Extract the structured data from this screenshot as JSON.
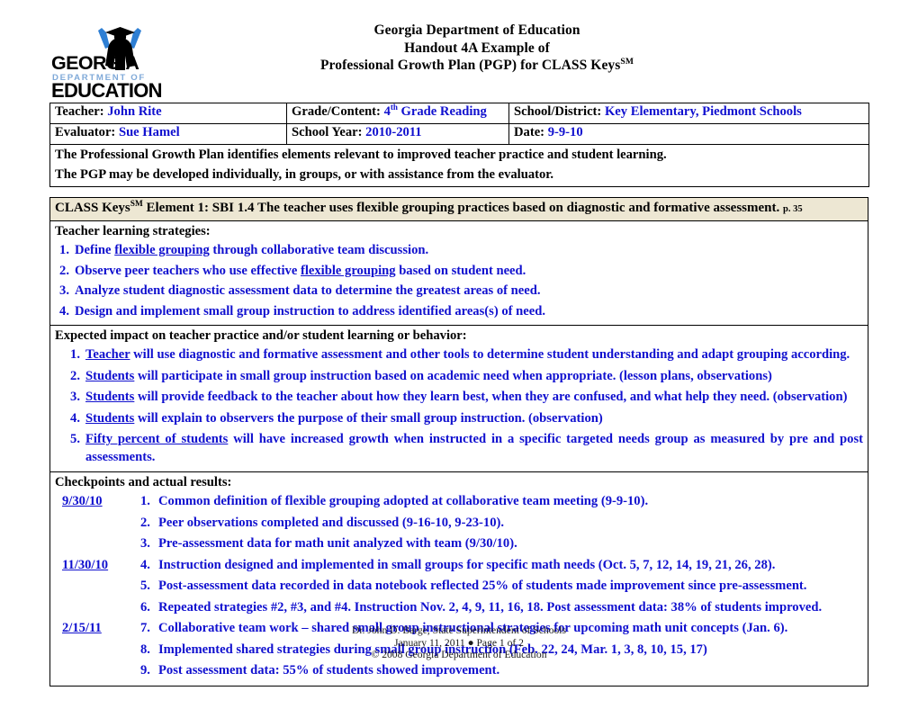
{
  "header": {
    "logo_alt": "Georgia Department of Education",
    "logo_word_top": "GEORGIA",
    "logo_word_mid": "DEPARTMENT OF",
    "logo_word_bottom": "EDUCATION",
    "title_line1": "Georgia Department of Education",
    "title_line2": "Handout 4A Example of",
    "title_line3_pre": "Professional Growth Plan (PGP) for CLASS Keys",
    "title_line3_sup": "SM"
  },
  "info": {
    "teacher_label": "Teacher:",
    "teacher_value": "John Rite",
    "grade_label": "Grade/Content:",
    "grade_value_num": "4",
    "grade_value_sup": "th",
    "grade_value_rest": " Grade Reading",
    "school_label": "School/District:",
    "school_value": "Key Elementary, Piedmont  Schools",
    "evaluator_label": "Evaluator:",
    "evaluator_value": "Sue Hamel",
    "year_label": "School Year:",
    "year_value": "2010-2011",
    "date_label": "Date:",
    "date_value": "9-9-10",
    "description_line1": "The Professional Growth Plan identifies elements relevant to improved teacher practice and student learning.",
    "description_line2": "The PGP may be developed individually, in groups, or with assistance from the evaluator."
  },
  "element": {
    "prefix": "CLASS Keys",
    "sup": "SM",
    "text": " Element 1:  SBI 1.4  The teacher uses flexible grouping practices based on diagnostic and formative assessment.",
    "page_ref": "p. 35"
  },
  "strategies": {
    "heading": "Teacher learning strategies:",
    "items": [
      {
        "num": "1.",
        "pre": "Define ",
        "underline": "flexible grouping",
        "post": " through collaborative team discussion."
      },
      {
        "num": "2.",
        "pre": "Observe peer teachers who use effective ",
        "underline": "flexible grouping",
        "post": " based on student need."
      },
      {
        "num": "3.",
        "pre": "Analyze student diagnostic assessment data to determine the greatest areas of need.",
        "underline": "",
        "post": ""
      },
      {
        "num": "4.",
        "pre": "Design and implement small group instruction to address identified areas(s) of need.",
        "underline": "",
        "post": ""
      }
    ]
  },
  "impact": {
    "heading": "Expected impact on teacher practice and/or student learning or behavior:",
    "items": [
      {
        "num": "1.",
        "underline": "Teacher",
        "post": " will use diagnostic and formative assessment and other tools to determine student understanding and adapt grouping according."
      },
      {
        "num": "2.",
        "underline": "Students",
        "post": " will participate in small group instruction based on academic need when appropriate. (lesson plans, observations)"
      },
      {
        "num": "3.",
        "underline": "Students",
        "post": " will provide feedback to the teacher about how they learn best, when they are confused, and what help they need. (observation)"
      },
      {
        "num": "4.",
        "underline": "Students",
        "post": " will explain to observers the purpose of their small group instruction. (observation)"
      },
      {
        "num": "5.",
        "underline": "Fifty percent of students",
        "post": " will have increased growth when instructed in a specific targeted needs group as measured by pre and post assessments."
      }
    ]
  },
  "checkpoints": {
    "heading": "Checkpoints and actual results:",
    "rows": [
      {
        "date": "9/30/10",
        "num": "1.",
        "text": "Common definition of flexible grouping adopted at collaborative team meeting (9-9-10)."
      },
      {
        "date": "",
        "num": "2.",
        "text": "Peer observations completed and discussed (9-16-10, 9-23-10)."
      },
      {
        "date": "",
        "num": "3.",
        "text": "Pre-assessment data for math unit analyzed with team (9/30/10)."
      },
      {
        "date": "11/30/10 ",
        "num": "4.",
        "text": "Instruction designed and implemented in small groups for specific math needs (Oct. 5, 7, 12, 14, 19, 21, 26, 28)."
      },
      {
        "date": "",
        "num": "5.",
        "text": "Post-assessment data recorded in data notebook reflected 25% of students made improvement since pre-assessment."
      },
      {
        "date": "",
        "num": "6.",
        "text": "Repeated strategies #2, #3, and #4.  Instruction Nov. 2, 4, 9, 11, 16, 18.  Post assessment data: 38% of students improved."
      },
      {
        "date": " 2/15/11 ",
        "num": "7.",
        "text": "Collaborative team work – shared small group instructional strategies for upcoming math unit concepts (Jan. 6)."
      },
      {
        "date": "",
        "num": "8.",
        "text": "Implemented shared strategies during small group instruction (Feb. 22, 24, Mar. 1, 3, 8, 10, 15, 17)"
      },
      {
        "date": "",
        "num": "9.",
        "text": "Post assessment data:  55% of students showed improvement."
      }
    ]
  },
  "footer": {
    "line1": "Dr. John D. Barge, State Superintendent of Schools",
    "line2": "January 11, 2011 ● Page 1 of 2",
    "line3": "© 2008 Georgia Department of Education"
  },
  "colors": {
    "blue_text": "#1010CF",
    "element_row_bg": "#EDE7D3",
    "logo_blue": "#2E7FD4",
    "border": "#000000"
  }
}
